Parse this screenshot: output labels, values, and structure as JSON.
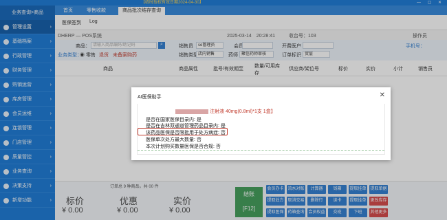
{
  "topbar": {
    "left": "",
    "notice": "【临时授权有效日期2024-04-30】",
    "window_controls": "— ▢ ✕"
  },
  "sidebar": {
    "header": "业务查询>商品",
    "items": [
      {
        "label": "管理设置",
        "active": true
      },
      {
        "label": "基础档案"
      },
      {
        "label": "行政管理"
      },
      {
        "label": "财务管理"
      },
      {
        "label": "购销运营"
      },
      {
        "label": "库房管理"
      },
      {
        "label": "会员运维"
      },
      {
        "label": "连锁管理"
      },
      {
        "label": "门店管理"
      },
      {
        "label": "质量管控"
      },
      {
        "label": "业务查询"
      },
      {
        "label": "决策支持"
      },
      {
        "label": "新增功能"
      }
    ]
  },
  "tabs": [
    "首页",
    "零售收款",
    "商品批次结存查询"
  ],
  "toolbar": {
    "btn1": "医保签到",
    "btn2": "Log"
  },
  "info": {
    "store": "DHERP — POS系统",
    "datetime": "2025-03-14　20:28:41",
    "counter": "收台号：103",
    "operator": "操作员"
  },
  "form": {
    "product_label": "商品：",
    "product_placeholder": "请输入商品编码/助记码",
    "seller_label": "销售员",
    "seller_value": "se管理员",
    "member_label": "会员",
    "member_placeholder": "",
    "doctor_label": "开费医户",
    "phone_label": "手机号：",
    "type_label": "业务类型：",
    "type_retail": "零售",
    "type_return": "退货",
    "type_unpaid": "未备案购药",
    "sale_type_label": "销售类型",
    "sale_type_value": "店内销售",
    "medicine_label": "药师",
    "medicine_value": "聚信药师审核",
    "order_label": "订单标识",
    "order_value": "贸层"
  },
  "table_headers": [
    "商品",
    "商品属性",
    "批号/有效期至",
    "数量/可用库存",
    "供应商/架位号",
    "标价",
    "实价",
    "小计",
    "销售员"
  ],
  "bottom": {
    "summary": "订单总 9  种商品，共  00  件",
    "labels": [
      "标价",
      "优惠",
      "实价"
    ],
    "values": [
      "¥ 0.00",
      "¥ 0.00",
      "¥ 0.00"
    ],
    "settle": "结账",
    "settle_key": "[F12]",
    "buttons": [
      "会员办卡",
      "流水对账",
      "计算器",
      "钱箱",
      "提取挂单",
      "提取单据",
      "提取处方",
      "取消交易",
      "删除行",
      "读卡",
      "提取挂单",
      "更改库存",
      "提取医保",
      "药箱查询",
      "会员权益",
      "交班",
      "下班",
      "其他更多"
    ]
  },
  "dialog": {
    "title": "AI医保助手",
    "close": "✕",
    "product": "注射液 40mg(0.8ml)*1支 1盒】",
    "lines": [
      "是否在国家医保目录内: 是",
      "是否在吉林双通道管理药品目录内: 是",
      "该药品医保是否限批用于处方病症: 否",
      "医保单次处方最大数量: 否",
      "本次计划购买数量医保是否合规: 否"
    ]
  }
}
